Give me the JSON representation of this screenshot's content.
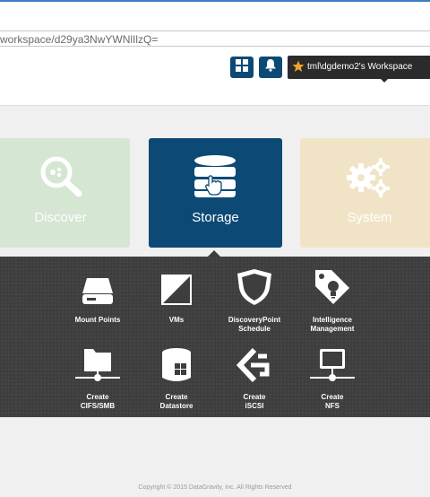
{
  "browser": {
    "url": "workspace/d29ya3NwYWNlIlzQ="
  },
  "header": {
    "workspace_label": "tml\\dgdemo2's Workspace",
    "brand_color": "#0c4a75",
    "icons": [
      "grid-icon",
      "bell-icon",
      "star-icon"
    ]
  },
  "tiles": [
    {
      "label": "Discover",
      "icon": "magnify-icon",
      "color": "#d5e6d3"
    },
    {
      "label": "Storage",
      "icon": "database-icon",
      "color": "#0c4a75"
    },
    {
      "label": "System",
      "icon": "gears-icon",
      "color": "#f1e4c6"
    }
  ],
  "storage_menu": {
    "row1": [
      {
        "line1": "Mount Points",
        "line2": "",
        "icon": "drive-icon"
      },
      {
        "line1": "VMs",
        "line2": "",
        "icon": "vm-icon"
      },
      {
        "line1": "DiscoveryPoint",
        "line2": "Schedule",
        "icon": "shield-icon"
      },
      {
        "line1": "Intelligence",
        "line2": "Management",
        "icon": "tag-bulb-icon"
      }
    ],
    "row2": [
      {
        "line1": "Create",
        "line2": "CIFS/SMB",
        "icon": "folder-network-icon"
      },
      {
        "line1": "Create",
        "line2": "Datastore",
        "icon": "datastore-icon"
      },
      {
        "line1": "Create",
        "line2": "iSCSI",
        "icon": "iscsi-icon"
      },
      {
        "line1": "Create",
        "line2": "NFS",
        "icon": "monitor-network-icon"
      }
    ]
  },
  "footer": {
    "copyright": "Copyright © 2015 DataGravity, Inc. All Rights Reserved"
  }
}
